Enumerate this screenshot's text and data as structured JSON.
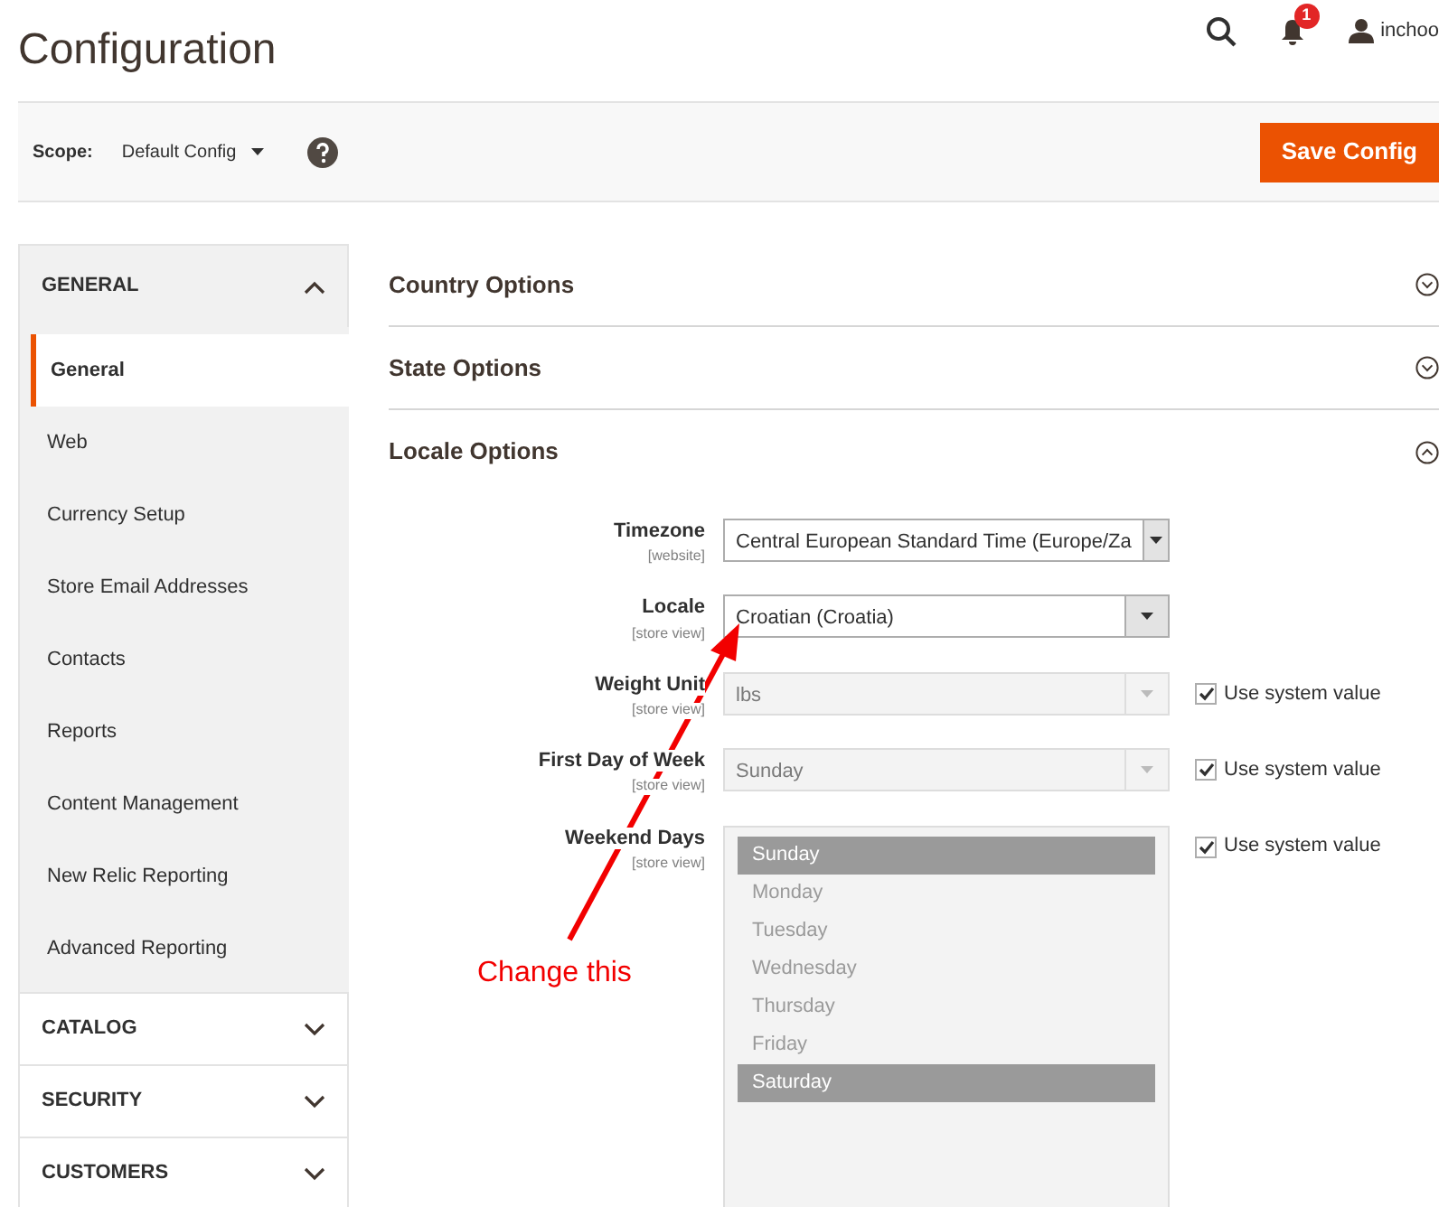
{
  "page_title": "Configuration",
  "header": {
    "notifications": "1",
    "user": "inchoo"
  },
  "scope": {
    "label": "Scope:",
    "value": "Default Config"
  },
  "save_button": "Save Config",
  "sidebar": [
    {
      "title": "GENERAL",
      "expanded": true,
      "children": [
        {
          "label": "General",
          "selected": true
        },
        {
          "label": "Web",
          "selected": false
        },
        {
          "label": "Currency Setup",
          "selected": false
        },
        {
          "label": "Store Email Addresses",
          "selected": false
        },
        {
          "label": "Contacts",
          "selected": false
        },
        {
          "label": "Reports",
          "selected": false
        },
        {
          "label": "Content Management",
          "selected": false
        },
        {
          "label": "New Relic Reporting",
          "selected": false
        },
        {
          "label": "Advanced Reporting",
          "selected": false
        }
      ]
    },
    {
      "title": "CATALOG",
      "expanded": false
    },
    {
      "title": "SECURITY",
      "expanded": false
    },
    {
      "title": "CUSTOMERS",
      "expanded": false
    }
  ],
  "sections": [
    {
      "title": "Country Options",
      "expanded": false
    },
    {
      "title": "State Options",
      "expanded": false
    },
    {
      "title": "Locale Options",
      "expanded": true
    }
  ],
  "fields": [
    {
      "kind": "select",
      "label": "Timezone",
      "scope": "[website]",
      "value": "Central European Standard Time (Europe/Za",
      "disabled": false
    },
    {
      "kind": "select",
      "label": "Locale",
      "scope": "[store view]",
      "value": "Croatian (Croatia)",
      "disabled": false
    },
    {
      "kind": "select",
      "label": "Weight Unit",
      "scope": "[store view]",
      "value": "lbs",
      "disabled": true,
      "system_value": {
        "label": "Use system value",
        "checked": true
      }
    },
    {
      "kind": "select",
      "label": "First Day of Week",
      "scope": "[store view]",
      "value": "Sunday",
      "disabled": true,
      "system_value": {
        "label": "Use system value",
        "checked": true
      }
    },
    {
      "kind": "multiselect",
      "label": "Weekend Days",
      "scope": "[store view]",
      "disabled": true,
      "system_value": {
        "label": "Use system value",
        "checked": true
      },
      "options": [
        {
          "label": "Sunday",
          "selected": true
        },
        {
          "label": "Monday",
          "selected": false
        },
        {
          "label": "Tuesday",
          "selected": false
        },
        {
          "label": "Wednesday",
          "selected": false
        },
        {
          "label": "Thursday",
          "selected": false
        },
        {
          "label": "Friday",
          "selected": false
        },
        {
          "label": "Saturday",
          "selected": true
        }
      ]
    }
  ],
  "annotation": {
    "text": "Change this"
  }
}
